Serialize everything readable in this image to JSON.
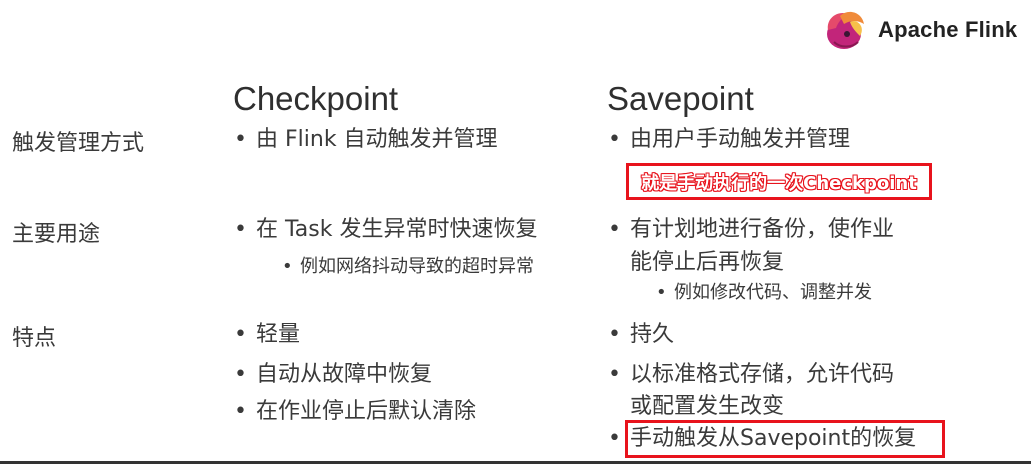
{
  "brand": {
    "name": "Apache Flink"
  },
  "headers": {
    "checkpoint": "Checkpoint",
    "savepoint": "Savepoint"
  },
  "rows": [
    {
      "label": "触发管理方式",
      "checkpoint": [
        "由 Flink 自动触发并管理"
      ],
      "savepoint": [
        "由用户手动触发并管理"
      ],
      "note": "就是手动执行的一次Checkpoint"
    },
    {
      "label": "主要用途",
      "checkpoint": [
        "在 Task 发生异常时快速恢复"
      ],
      "checkpoint_sub": [
        "例如网络抖动导致的超时异常"
      ],
      "savepoint_lines": [
        "有计划地进行备份，使作业",
        "能停止后再恢复"
      ],
      "savepoint_sub": [
        "例如修改代码、调整并发"
      ]
    },
    {
      "label": "特点",
      "checkpoint": [
        "轻量",
        "自动从故障中恢复",
        "在作业停止后默认清除"
      ],
      "savepoint": [
        "持久"
      ],
      "savepoint_multi_lines": [
        "以标准格式存储，允许代码",
        "或配置发生改变"
      ],
      "savepoint_highlight": "手动触发从Savepoint的恢复"
    }
  ]
}
